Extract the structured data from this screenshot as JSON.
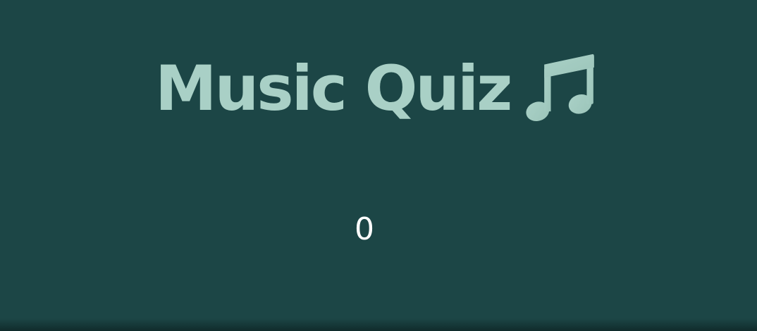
{
  "header": {
    "title": "Music Quiz",
    "icon": "music-note-icon",
    "title_color": "#a9d0c6"
  },
  "main": {
    "score": "0"
  },
  "colors": {
    "background": "#1c4646",
    "score_text": "#ffffff"
  }
}
